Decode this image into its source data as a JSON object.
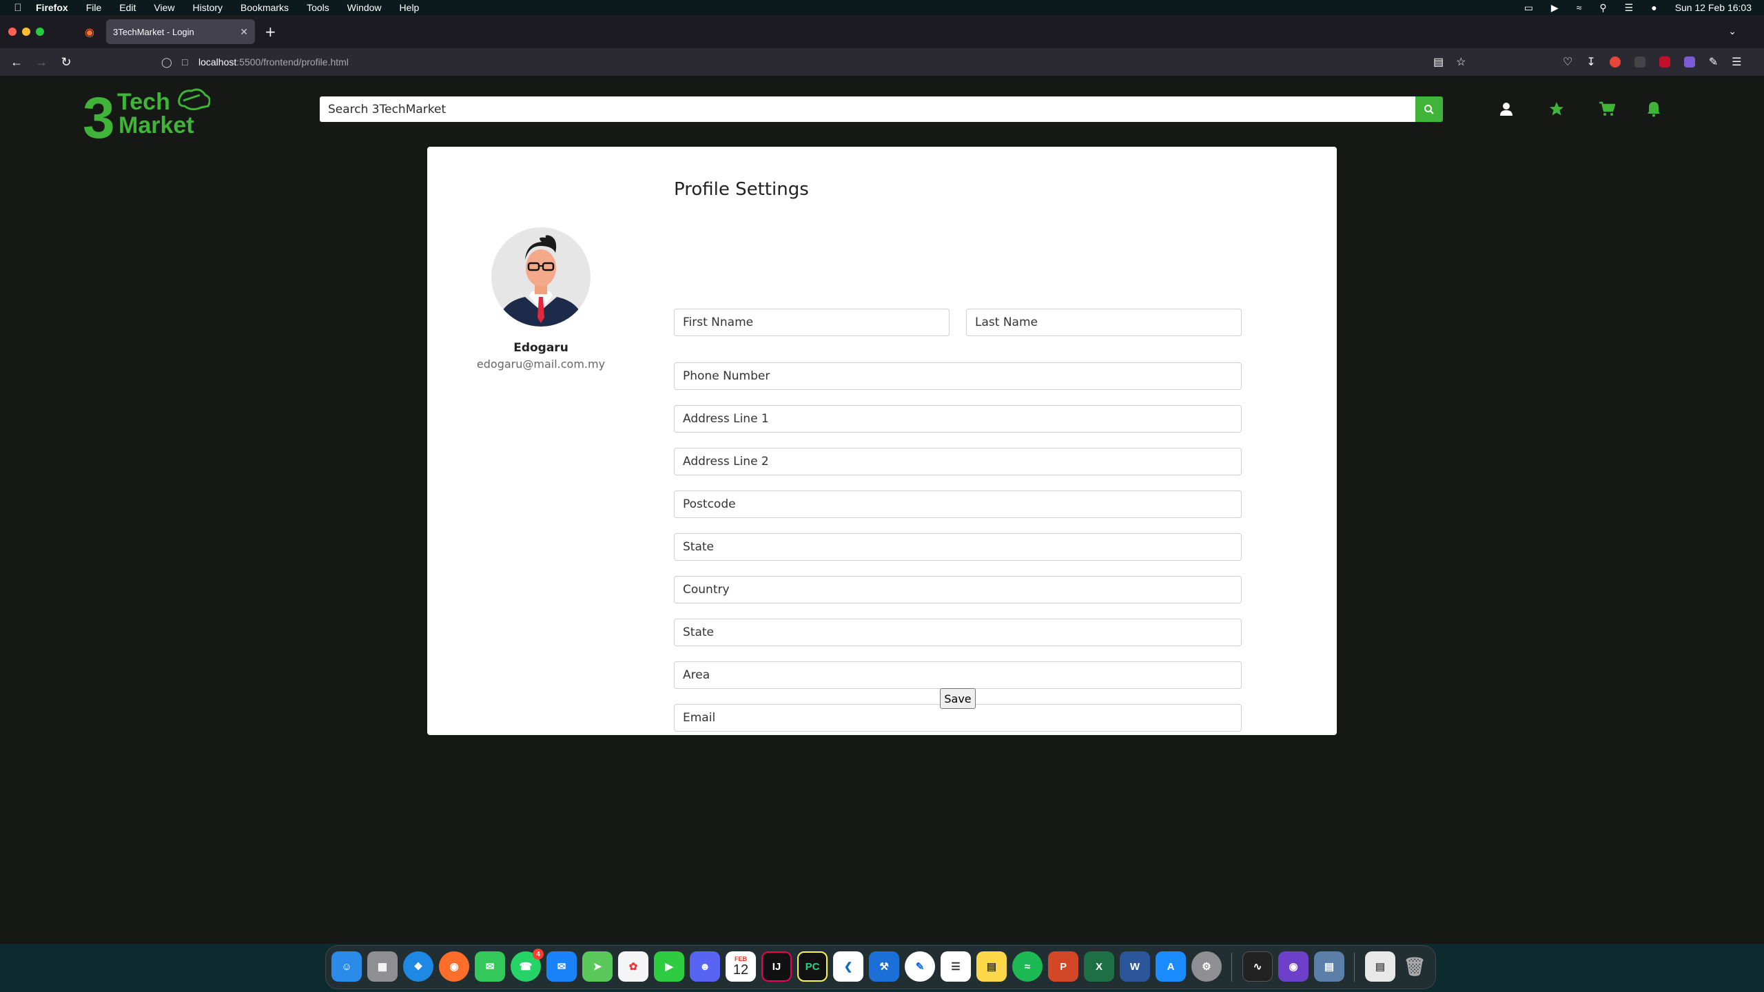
{
  "menubar": {
    "app": "Firefox",
    "items": [
      "File",
      "Edit",
      "View",
      "History",
      "Bookmarks",
      "Tools",
      "Window",
      "Help"
    ],
    "clock": "Sun 12 Feb  16:03"
  },
  "browser": {
    "tab_title": "3TechMarket - Login",
    "url_host": "localhost",
    "url_path": ":5500/frontend/profile.html"
  },
  "site": {
    "logo_line1": "Tech",
    "logo_line2": "Market",
    "logo_digit": "3",
    "search_placeholder": "Search 3TechMarket",
    "accent": "#40b339"
  },
  "profile": {
    "title": "Profile Settings",
    "name": "Edogaru",
    "email": "edogaru@mail.com.my",
    "fields": {
      "first_name": "First Nname",
      "last_name": "Last Name",
      "phone": "Phone Number",
      "address1": "Address Line 1",
      "address2": "Address Line 2",
      "postcode": "Postcode",
      "state": "State",
      "country": "Country",
      "state2": "State",
      "area": "Area",
      "email": "Email"
    },
    "save_label": "Save"
  },
  "dock": {
    "calendar_month": "FEB",
    "calendar_day": "12",
    "whatsapp_badge": "4"
  }
}
